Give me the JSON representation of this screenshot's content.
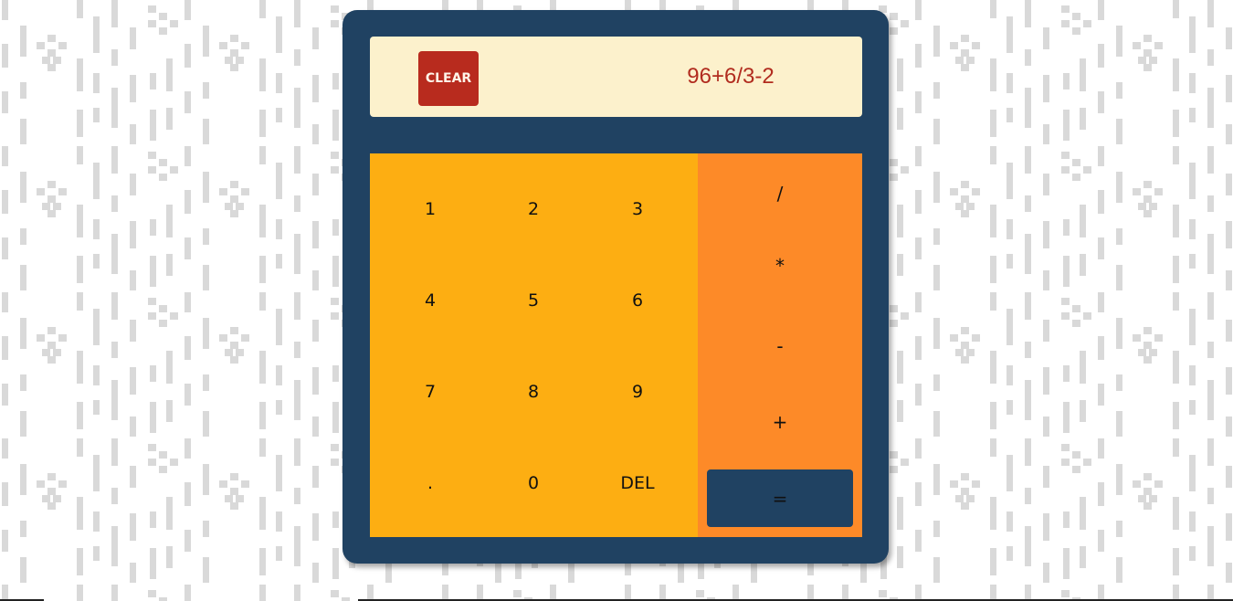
{
  "colors": {
    "calculator_body": "#204262",
    "display_bg": "#fcf1cc",
    "clear_button": "#b82b1e",
    "expression_text": "#b12c1f",
    "number_pad": "#fdae12",
    "operator_pad": "#fd8a28",
    "equals_button": "#204262",
    "pattern": "#d9d9d9"
  },
  "display": {
    "clear_label": "CLEAR",
    "expression": "96+6/3-2"
  },
  "keypad": {
    "keys": [
      "1",
      "2",
      "3",
      "4",
      "5",
      "6",
      "7",
      "8",
      "9",
      ".",
      "0",
      "DEL"
    ]
  },
  "operators": {
    "divide": "/",
    "multiply": "*",
    "subtract": "-",
    "add": "+",
    "equals": "="
  }
}
